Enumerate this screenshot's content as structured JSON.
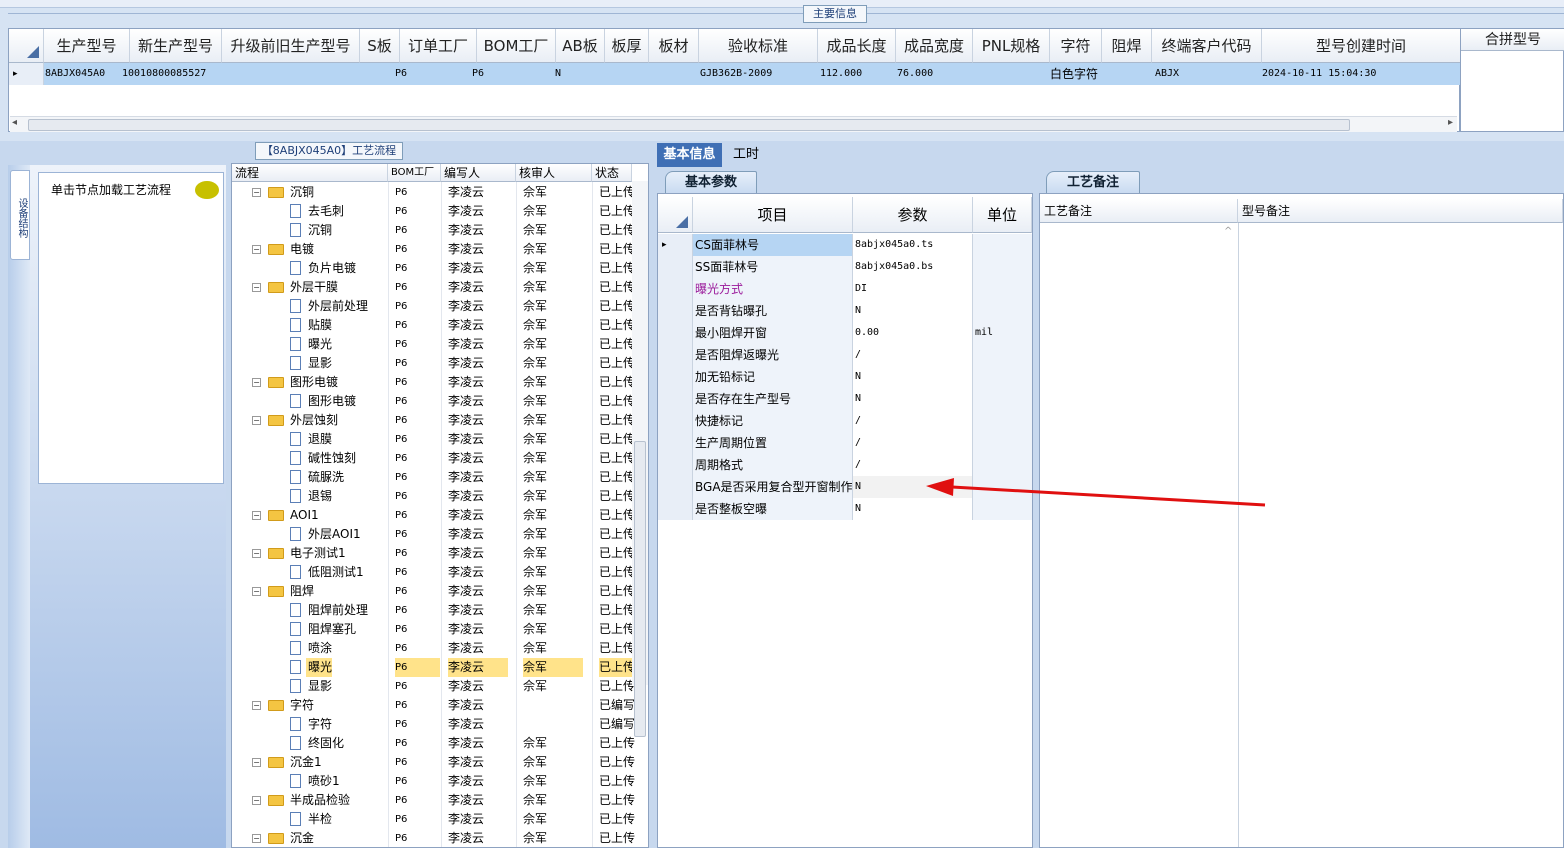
{
  "main_info": {
    "caption": "主要信息",
    "headers": [
      "生产型号",
      "新生产型号",
      "升级前旧生产型号",
      "S板",
      "订单工厂",
      "BOM工厂",
      "AB板",
      "板厚",
      "板材",
      "验收标准",
      "成品长度",
      "成品宽度",
      "PNL规格",
      "字符",
      "阻焊",
      "终端客户代码",
      "型号创建时间"
    ],
    "row": {
      "marker": "▸",
      "prod_model": "8ABJX045A0",
      "new_model": "10010800085527",
      "order_factory": "P6",
      "bom_factory": "P6",
      "ab_board": "N",
      "acceptance": "GJB362B-2009",
      "length": "112.000",
      "width": "76.000",
      "character": "白色字符",
      "customer_code": "ABJX",
      "created": "2024-10-11 15:04:30"
    },
    "merge_header": "合拼型号",
    "scroll_left": "◂",
    "scroll_right": "▸"
  },
  "left_panel": {
    "vtab": "设备结构",
    "hint": "单击节点加载工艺流程"
  },
  "process": {
    "caption": "【8ABJX045A0】工艺流程",
    "headers": [
      "流程",
      "BOM工厂",
      "编写人",
      "核审人",
      "状态"
    ],
    "rows": [
      {
        "level": 1,
        "name": "沉铜",
        "bom": "P6",
        "writer": "李凌云",
        "checker": "佘军",
        "status": "已上传"
      },
      {
        "level": 2,
        "name": "去毛刺",
        "bom": "P6",
        "writer": "李凌云",
        "checker": "佘军",
        "status": "已上传"
      },
      {
        "level": 2,
        "name": "沉铜",
        "bom": "P6",
        "writer": "李凌云",
        "checker": "佘军",
        "status": "已上传"
      },
      {
        "level": 1,
        "name": "电镀",
        "bom": "P6",
        "writer": "李凌云",
        "checker": "佘军",
        "status": "已上传"
      },
      {
        "level": 2,
        "name": "负片电镀",
        "bom": "P6",
        "writer": "李凌云",
        "checker": "佘军",
        "status": "已上传"
      },
      {
        "level": 1,
        "name": "外层干膜",
        "bom": "P6",
        "writer": "李凌云",
        "checker": "佘军",
        "status": "已上传"
      },
      {
        "level": 2,
        "name": "外层前处理",
        "bom": "P6",
        "writer": "李凌云",
        "checker": "佘军",
        "status": "已上传"
      },
      {
        "level": 2,
        "name": "贴膜",
        "bom": "P6",
        "writer": "李凌云",
        "checker": "佘军",
        "status": "已上传"
      },
      {
        "level": 2,
        "name": "曝光",
        "bom": "P6",
        "writer": "李凌云",
        "checker": "佘军",
        "status": "已上传"
      },
      {
        "level": 2,
        "name": "显影",
        "bom": "P6",
        "writer": "李凌云",
        "checker": "佘军",
        "status": "已上传"
      },
      {
        "level": 1,
        "name": "图形电镀",
        "bom": "P6",
        "writer": "李凌云",
        "checker": "佘军",
        "status": "已上传"
      },
      {
        "level": 2,
        "name": "图形电镀",
        "bom": "P6",
        "writer": "李凌云",
        "checker": "佘军",
        "status": "已上传"
      },
      {
        "level": 1,
        "name": "外层蚀刻",
        "bom": "P6",
        "writer": "李凌云",
        "checker": "佘军",
        "status": "已上传"
      },
      {
        "level": 2,
        "name": "退膜",
        "bom": "P6",
        "writer": "李凌云",
        "checker": "佘军",
        "status": "已上传"
      },
      {
        "level": 2,
        "name": "碱性蚀刻",
        "bom": "P6",
        "writer": "李凌云",
        "checker": "佘军",
        "status": "已上传"
      },
      {
        "level": 2,
        "name": "硫脲洗",
        "bom": "P6",
        "writer": "李凌云",
        "checker": "佘军",
        "status": "已上传"
      },
      {
        "level": 2,
        "name": "退锡",
        "bom": "P6",
        "writer": "李凌云",
        "checker": "佘军",
        "status": "已上传"
      },
      {
        "level": 1,
        "name": "AOI1",
        "bom": "P6",
        "writer": "李凌云",
        "checker": "佘军",
        "status": "已上传"
      },
      {
        "level": 2,
        "name": "外层AOI1",
        "bom": "P6",
        "writer": "李凌云",
        "checker": "佘军",
        "status": "已上传"
      },
      {
        "level": 1,
        "name": "电子测试1",
        "bom": "P6",
        "writer": "李凌云",
        "checker": "佘军",
        "status": "已上传"
      },
      {
        "level": 2,
        "name": "低阻测试1",
        "bom": "P6",
        "writer": "李凌云",
        "checker": "佘军",
        "status": "已上传"
      },
      {
        "level": 1,
        "name": "阻焊",
        "bom": "P6",
        "writer": "李凌云",
        "checker": "佘军",
        "status": "已上传"
      },
      {
        "level": 2,
        "name": "阻焊前处理",
        "bom": "P6",
        "writer": "李凌云",
        "checker": "佘军",
        "status": "已上传"
      },
      {
        "level": 2,
        "name": "阻焊塞孔",
        "bom": "P6",
        "writer": "李凌云",
        "checker": "佘军",
        "status": "已上传"
      },
      {
        "level": 2,
        "name": "喷涂",
        "bom": "P6",
        "writer": "李凌云",
        "checker": "佘军",
        "status": "已上传"
      },
      {
        "level": 2,
        "name": "曝光",
        "bom": "P6",
        "writer": "李凌云",
        "checker": "佘军",
        "status": "已上传",
        "selected": true
      },
      {
        "level": 2,
        "name": "显影",
        "bom": "P6",
        "writer": "李凌云",
        "checker": "佘军",
        "status": "已上传"
      },
      {
        "level": 1,
        "name": "字符",
        "bom": "P6",
        "writer": "李凌云",
        "checker": "",
        "status": "已编写"
      },
      {
        "level": 2,
        "name": "字符",
        "bom": "P6",
        "writer": "李凌云",
        "checker": "",
        "status": "已编写"
      },
      {
        "level": 2,
        "name": "终固化",
        "bom": "P6",
        "writer": "李凌云",
        "checker": "佘军",
        "status": "已上传"
      },
      {
        "level": 1,
        "name": "沉金1",
        "bom": "P6",
        "writer": "李凌云",
        "checker": "佘军",
        "status": "已上传"
      },
      {
        "level": 2,
        "name": "喷砂1",
        "bom": "P6",
        "writer": "李凌云",
        "checker": "佘军",
        "status": "已上传"
      },
      {
        "level": 1,
        "name": "半成品检验",
        "bom": "P6",
        "writer": "李凌云",
        "checker": "佘军",
        "status": "已上传"
      },
      {
        "level": 2,
        "name": "半检",
        "bom": "P6",
        "writer": "李凌云",
        "checker": "佘军",
        "status": "已上传"
      },
      {
        "level": 1,
        "name": "沉金",
        "bom": "P6",
        "writer": "李凌云",
        "checker": "佘军",
        "status": "已上传"
      }
    ]
  },
  "right": {
    "tabs": [
      "基本信息",
      "工时"
    ],
    "subtab_basic": "基本参数",
    "subtab_note": "工艺备注",
    "param_headers": [
      "项目",
      "参数",
      "单位"
    ],
    "params": [
      {
        "item": "CS面菲林号",
        "value": "8abjx045a0.ts",
        "unit": "",
        "marker": "▸",
        "highlight": true
      },
      {
        "item": "SS面菲林号",
        "value": "8abjx045a0.bs",
        "unit": ""
      },
      {
        "item": "曝光方式",
        "value": "DI",
        "unit": "",
        "purple": true
      },
      {
        "item": "是否背钻曝孔",
        "value": "N",
        "unit": ""
      },
      {
        "item": "最小阻焊开窗",
        "value": "0.00",
        "unit": "mil"
      },
      {
        "item": "是否阻焊返曝光",
        "value": "/",
        "unit": ""
      },
      {
        "item": "加无铅标记",
        "value": "N",
        "unit": ""
      },
      {
        "item": "是否存在生产型号",
        "value": "N",
        "unit": ""
      },
      {
        "item": "快捷标记",
        "value": "/",
        "unit": ""
      },
      {
        "item": "生产周期位置",
        "value": "/",
        "unit": ""
      },
      {
        "item": "周期格式",
        "value": "/",
        "unit": ""
      },
      {
        "item": "BGA是否采用复合型开窗制作",
        "value": "N",
        "unit": ""
      },
      {
        "item": "是否整板空曝",
        "value": "N",
        "unit": ""
      }
    ],
    "note_headers": [
      "工艺备注",
      "型号备注"
    ]
  },
  "colors": {
    "accent": "#3f6fb5",
    "selected_row": "#b6d5f3",
    "tree_sel": "#ffe38a",
    "arrow": "#e01010",
    "purple": "#9b1a9b"
  }
}
